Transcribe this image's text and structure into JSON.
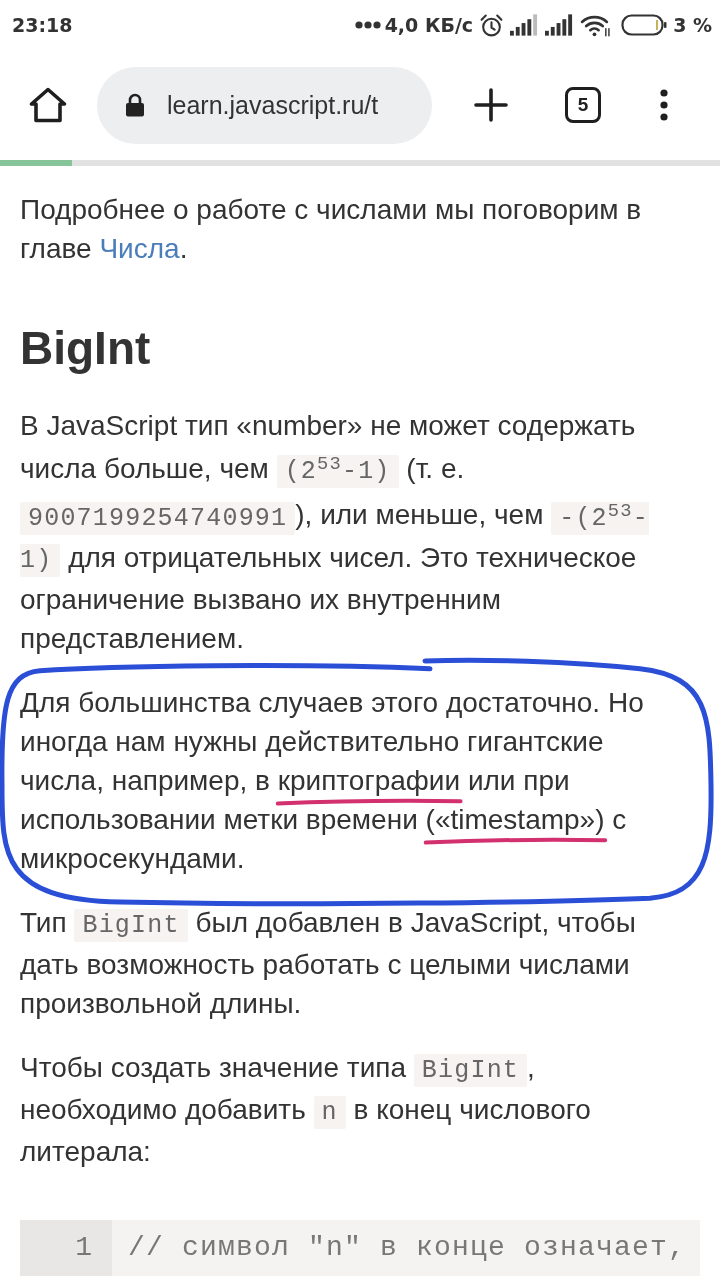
{
  "status_bar": {
    "time": "23:18",
    "speed": "4,0 КБ/с",
    "battery": "3 %"
  },
  "browser_toolbar": {
    "url": "learn.javascript.ru/t",
    "tab_count": "5",
    "progress": {
      "level": 0.1
    }
  },
  "article": [
    {
      "kind": "paragraph",
      "circled": false,
      "segments": [
        {
          "kind": "text",
          "text": "Подробнее о работе с числами мы поговорим в главе "
        },
        {
          "kind": "link",
          "text": "Числа"
        },
        {
          "kind": "text",
          "text": "."
        }
      ]
    },
    {
      "kind": "heading",
      "text": "BigInt"
    },
    {
      "kind": "paragraph",
      "circled": false,
      "segments": [
        {
          "kind": "text",
          "text": "В JavaScript тип «number» не может содержать числа больше, чем "
        },
        {
          "kind": "code",
          "text": "(2$^{53}$-1)"
        },
        {
          "kind": "text",
          "text": " (т. е. "
        },
        {
          "kind": "code",
          "text": "9007199254740991"
        },
        {
          "kind": "text",
          "text": "), или меньше, чем "
        },
        {
          "kind": "code",
          "text": "-(2$^{53}$-1)"
        },
        {
          "kind": "text",
          "text": " для отрицательных чисел. Это техническое ограничение вызвано их внутренним представлением."
        }
      ]
    },
    {
      "kind": "paragraph",
      "circled": true,
      "segments": [
        {
          "kind": "text",
          "text": "Для большинства случаев этого достаточно. Но иногда нам нужны действительно гигантские числа, например, в "
        },
        {
          "kind": "underlined",
          "text": "криптографии"
        },
        {
          "kind": "text",
          "text": " или при использовании метки времени "
        },
        {
          "kind": "underlined",
          "text": "(«timestamp»)"
        },
        {
          "kind": "text",
          "text": " с микросекундами."
        }
      ]
    },
    {
      "kind": "paragraph",
      "circled": false,
      "segments": [
        {
          "kind": "text",
          "text": "Тип "
        },
        {
          "kind": "code",
          "text": "BigInt"
        },
        {
          "kind": "text",
          "text": " был добавлен в JavaScript, чтобы дать возможность работать с целыми числами произвольной длины."
        }
      ]
    },
    {
      "kind": "paragraph",
      "circled": false,
      "segments": [
        {
          "kind": "text",
          "text": "Чтобы создать значение типа "
        },
        {
          "kind": "code",
          "text": "BigInt"
        },
        {
          "kind": "text",
          "text": ", необходимо добавить "
        },
        {
          "kind": "code",
          "text": "n"
        },
        {
          "kind": "text",
          "text": " в конец числового литерала:"
        }
      ]
    },
    {
      "kind": "code_block",
      "lines": [
        {
          "number": "1",
          "code": "// символ \"n\" в конце означает,"
        }
      ]
    }
  ]
}
